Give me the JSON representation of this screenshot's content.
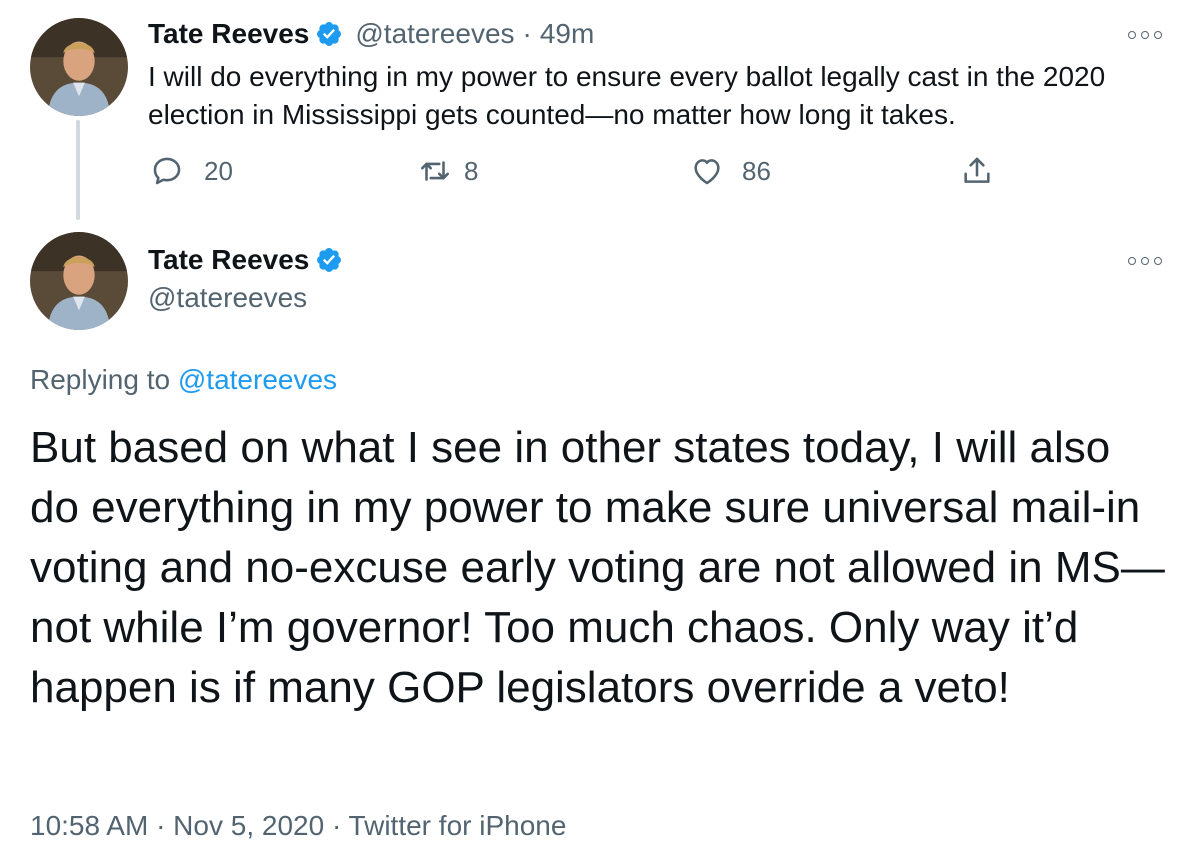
{
  "tweet1": {
    "display_name": "Tate Reeves",
    "handle": "@tatereeves",
    "separator": "·",
    "time_ago": "49m",
    "text": "I will do everything in my power to ensure every ballot legally cast in the 2020 election in Mississippi gets counted—no matter how long it takes.",
    "actions": {
      "reply_count": "20",
      "retweet_count": "8",
      "like_count": "86"
    },
    "icons": [
      "avatar-photo",
      "verified-badge-icon",
      "more-options-icon",
      "reply-icon",
      "retweet-icon",
      "like-icon",
      "share-icon"
    ]
  },
  "tweet2": {
    "display_name": "Tate Reeves",
    "handle": "@tatereeves",
    "replying_prefix": "Replying to",
    "replying_to": "@tatereeves",
    "text": "But based on what I see in other states today, I will also do everything in my power to make sure universal mail-in voting and no-excuse early voting are not allowed in MS—not while I’m governor! Too much chaos. Only way it’d happen is if many GOP legislators override a veto!",
    "meta": "10:58 AM · Nov 5, 2020 · Twitter for iPhone"
  },
  "colors": {
    "text_primary": "#0f1419",
    "text_secondary": "#536471",
    "accent": "#1d9bf0",
    "thread_line": "#cfd9de"
  }
}
